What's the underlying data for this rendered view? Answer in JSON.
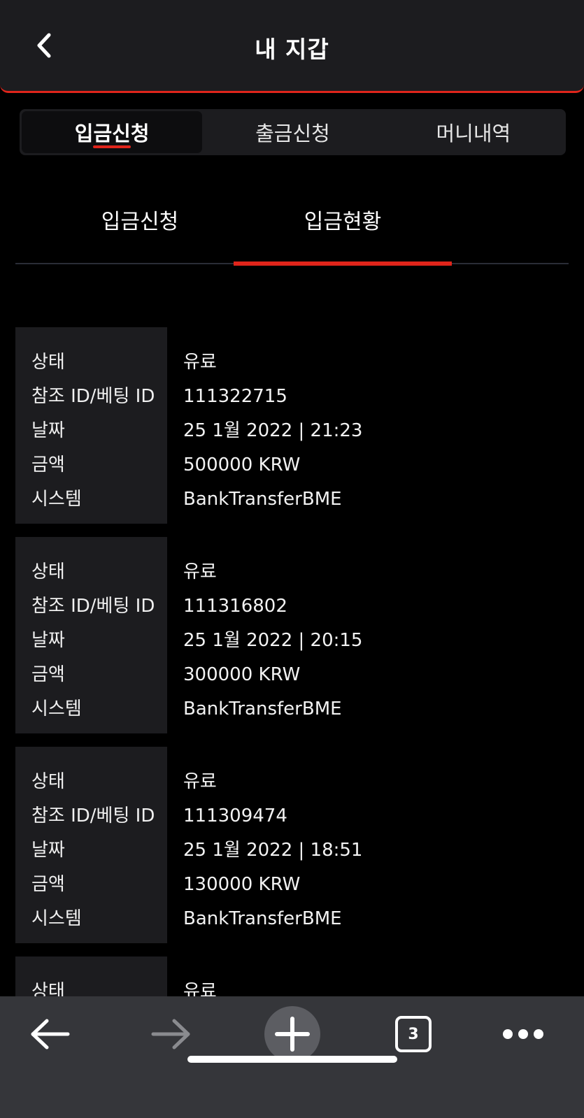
{
  "header": {
    "title": "내 지갑"
  },
  "top_tabs": [
    {
      "label": "입금신청",
      "active": true
    },
    {
      "label": "출금신청",
      "active": false
    },
    {
      "label": "머니내역",
      "active": false
    }
  ],
  "sub_tabs": [
    {
      "label": "입금신청",
      "active": false
    },
    {
      "label": "입금현황",
      "active": true
    }
  ],
  "field_labels": {
    "status": "상태",
    "ref_id": "참조 ID/베팅 ID",
    "date": "날짜",
    "amount": "금액",
    "system": "시스템"
  },
  "records": [
    {
      "status": "유료",
      "ref_id": "111322715",
      "date": "25 1월 2022 | 21:23",
      "amount": "500000 KRW",
      "system": "BankTransferBME"
    },
    {
      "status": "유료",
      "ref_id": "111316802",
      "date": "25 1월 2022 | 20:15",
      "amount": "300000 KRW",
      "system": "BankTransferBME"
    },
    {
      "status": "유료",
      "ref_id": "111309474",
      "date": "25 1월 2022 | 18:51",
      "amount": "130000 KRW",
      "system": "BankTransferBME"
    },
    {
      "status": "유료"
    }
  ],
  "browser_bar": {
    "tab_count": "3"
  },
  "colors": {
    "accent": "#e0251b",
    "panel": "#1c1c1f",
    "toolbar": "#35363a"
  }
}
